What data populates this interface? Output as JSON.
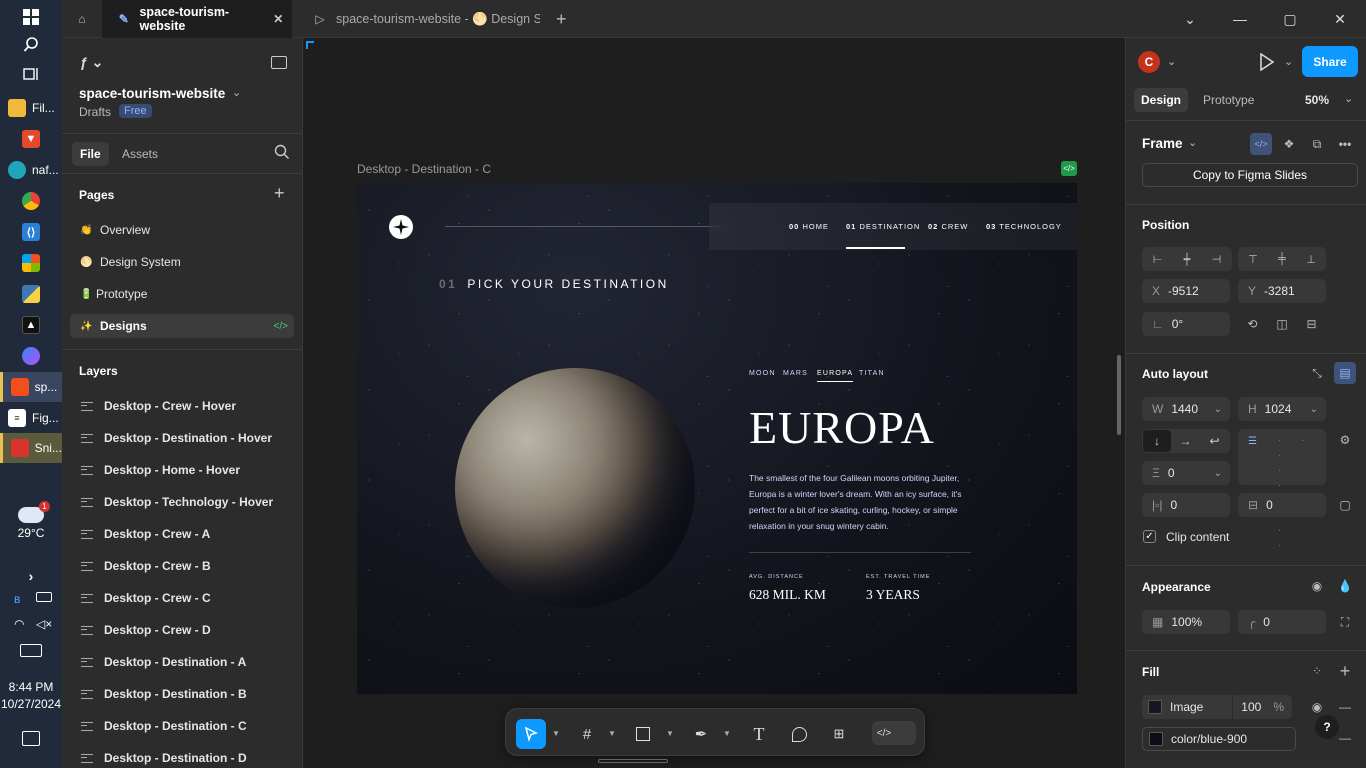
{
  "taskbar": {
    "apps": [
      {
        "label": "Fil..."
      },
      {
        "label": ""
      },
      {
        "label": "naf..."
      },
      {
        "label": ""
      },
      {
        "label": ""
      },
      {
        "label": ""
      },
      {
        "label": ""
      },
      {
        "label": ""
      },
      {
        "label": ""
      },
      {
        "label": "sp..."
      },
      {
        "label": "Fig..."
      },
      {
        "label": "Sni..."
      }
    ],
    "weather": {
      "temp": "29°C",
      "badge": "1"
    },
    "clock": {
      "time": "8:44 PM",
      "date": "10/27/2024"
    }
  },
  "tabs": [
    {
      "label": "space-tourism-website",
      "active": true
    },
    {
      "label": "space-tourism-website - 🌕 Design S",
      "active": false
    }
  ],
  "left_panel": {
    "file_name": "space-tourism-website",
    "location": "Drafts",
    "plan_badge": "Free",
    "tabs": {
      "file": "File",
      "assets": "Assets"
    },
    "pages_title": "Pages",
    "pages": [
      {
        "emoji": "👏",
        "label": "Overview"
      },
      {
        "emoji": "🌕",
        "label": "Design System"
      },
      {
        "emoji": "🔋",
        "label": "Prototype"
      },
      {
        "emoji": "✨",
        "label": "Designs",
        "selected": true
      }
    ],
    "layers_title": "Layers",
    "layers": [
      "Desktop - Crew - Hover",
      "Desktop - Destination - Hover",
      "Desktop - Home - Hover",
      "Desktop - Technology - Hover",
      "Desktop - Crew - A",
      "Desktop - Crew - B",
      "Desktop - Crew - C",
      "Desktop - Crew - D",
      "Desktop - Destination - A",
      "Desktop - Destination - B",
      "Desktop - Destination - C",
      "Desktop - Destination - D"
    ]
  },
  "canvas": {
    "frame_label": "Desktop - Destination - C",
    "site": {
      "nav": [
        {
          "num": "00",
          "label": "HOME"
        },
        {
          "num": "01",
          "label": "DESTINATION",
          "active": true
        },
        {
          "num": "02",
          "label": "CREW"
        },
        {
          "num": "03",
          "label": "TECHNOLOGY"
        }
      ],
      "heading_num": "01",
      "heading": "PICK YOUR DESTINATION",
      "dest_tabs": [
        {
          "label": "MOON"
        },
        {
          "label": "MARS"
        },
        {
          "label": "EUROPA",
          "active": true
        },
        {
          "label": "TITAN"
        }
      ],
      "title": "EUROPA",
      "description": "The smallest of the four Galilean moons orbiting Jupiter, Europa is a winter lover's dream. With an icy surface, it's perfect for a bit of ice skating, curling, hockey, or simple relaxation in your snug wintery cabin.",
      "stats": [
        {
          "label": "AVG. DISTANCE",
          "value": "628 MIL. KM"
        },
        {
          "label": "EST. TRAVEL TIME",
          "value": "3 YEARS"
        }
      ]
    }
  },
  "right_panel": {
    "avatar_letter": "C",
    "share_label": "Share",
    "tabs": {
      "design": "Design",
      "prototype": "Prototype"
    },
    "zoom": "50%",
    "frame_label": "Frame",
    "copy_slides": "Copy to Figma Slides",
    "position": {
      "title": "Position",
      "x_label": "X",
      "x": "-9512",
      "y_label": "Y",
      "y": "-3281",
      "rotation": "0°"
    },
    "auto_layout": {
      "title": "Auto layout",
      "w_label": "W",
      "w": "1440",
      "h_label": "H",
      "h": "1024",
      "gap": "0",
      "pad_h": "0",
      "pad_v": "0",
      "clip_content": "Clip content"
    },
    "appearance": {
      "title": "Appearance",
      "opacity": "100%",
      "radius": "0"
    },
    "fill": {
      "title": "Fill",
      "type": "Image",
      "opacity": "100",
      "percent": "%",
      "style": "color/blue-900"
    },
    "help": "?"
  },
  "colors": {
    "accent": "#0d99ff",
    "avatar": "#c4321e",
    "free_badge_bg": "#394b73",
    "free_badge_text": "#8fb5ff"
  }
}
